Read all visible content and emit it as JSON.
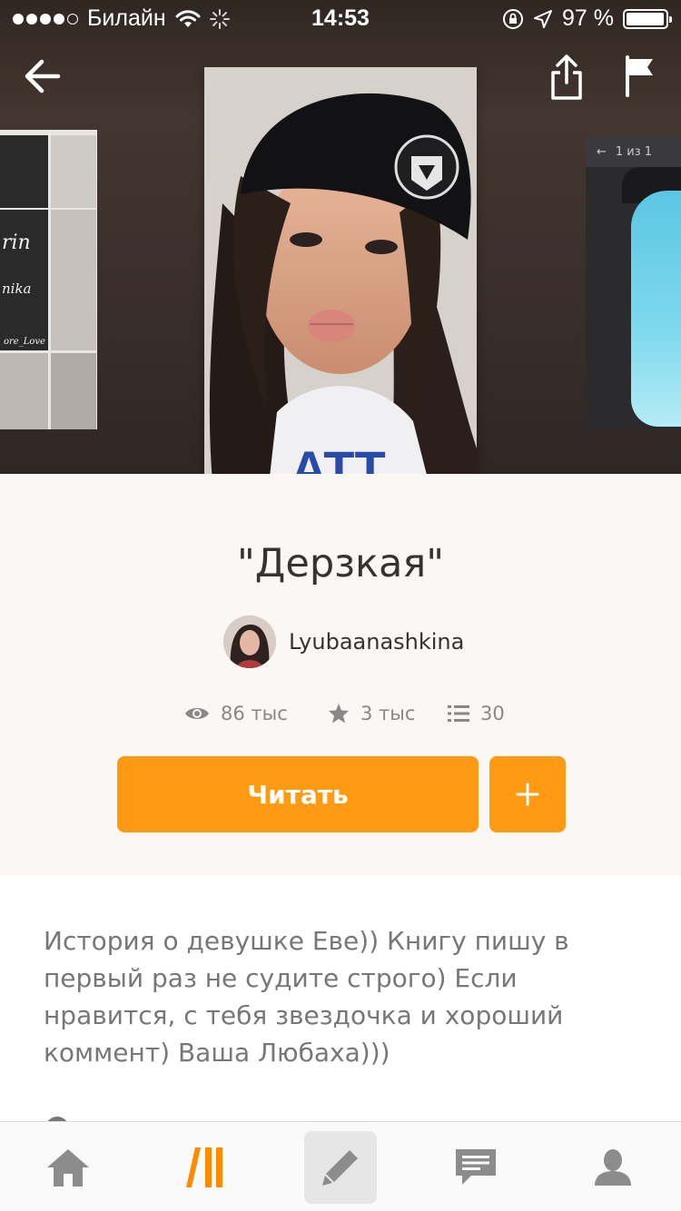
{
  "status_bar": {
    "carrier": "Билайн",
    "time": "14:53",
    "battery": "97 %",
    "battery_level": 0.97
  },
  "icons": {
    "back": "arrow-left-icon",
    "share": "share-icon",
    "flag": "flag-icon",
    "views": "eye-icon",
    "votes": "star-icon",
    "parts": "list-icon",
    "add": "plus-icon",
    "tabs": [
      "home-icon",
      "discover-icon",
      "pencil-icon",
      "messages-icon",
      "profile-icon"
    ]
  },
  "colors": {
    "accent": "#ff9a12",
    "hero_bg": "#3e322d",
    "text_muted": "#777777"
  },
  "side_covers": {
    "right_counter": "1 из 1"
  },
  "story": {
    "title": "\"Дерзкая\"",
    "author": "Lyubaanashkina",
    "views": "86 тыс",
    "votes": "3 тыс",
    "parts": "30",
    "read_label": "Читать",
    "description": "История о девушке Еве)) Книгу пишу в первый раз не судите строго) Если нравится, с тебя звездочка и хороший коммент) Ваша Любаха)))"
  }
}
